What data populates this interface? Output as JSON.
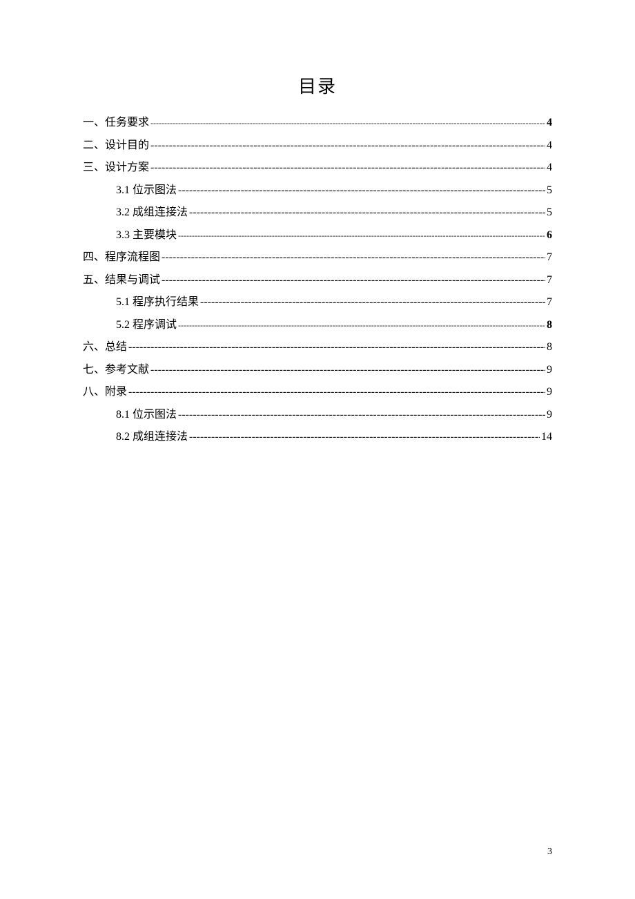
{
  "title": "目录",
  "entries": [
    {
      "label": "一、任务要求",
      "page": "4",
      "indent": false,
      "boldPage": true,
      "leader": "dot"
    },
    {
      "label": "二、设计目的",
      "page": "4",
      "indent": false,
      "boldPage": false,
      "leader": "dash"
    },
    {
      "label": "三、设计方案",
      "page": "4",
      "indent": false,
      "boldPage": false,
      "leader": "dash"
    },
    {
      "label": "3.1 位示图法",
      "page": "5",
      "indent": true,
      "boldPage": false,
      "leader": "dash"
    },
    {
      "label": "3.2 成组连接法",
      "page": "5",
      "indent": true,
      "boldPage": false,
      "leader": "dash"
    },
    {
      "label": "3.3 主要模块",
      "page": "6",
      "indent": true,
      "boldPage": true,
      "leader": "dot"
    },
    {
      "label": "四、程序流程图",
      "page": "7",
      "indent": false,
      "boldPage": false,
      "leader": "dash"
    },
    {
      "label": "五、结果与调试",
      "page": "7",
      "indent": false,
      "boldPage": false,
      "leader": "dash"
    },
    {
      "label": "5.1 程序执行结果",
      "page": "7",
      "indent": true,
      "boldPage": false,
      "leader": "dash"
    },
    {
      "label": "5.2 程序调试",
      "page": "8",
      "indent": true,
      "boldPage": true,
      "leader": "dot"
    },
    {
      "label": "六、总结",
      "page": "8",
      "indent": false,
      "boldPage": false,
      "leader": "dash"
    },
    {
      "label": "七、参考文献",
      "page": "9",
      "indent": false,
      "boldPage": false,
      "leader": "dash"
    },
    {
      "label": "八、附录",
      "page": "9",
      "indent": false,
      "boldPage": false,
      "leader": "dash"
    },
    {
      "label": "8.1 位示图法",
      "page": "9",
      "indent": true,
      "boldPage": false,
      "leader": "dash"
    },
    {
      "label": "8.2 成组连接法",
      "page": "14",
      "indent": true,
      "boldPage": false,
      "leader": "dash"
    }
  ],
  "page_number": "3"
}
